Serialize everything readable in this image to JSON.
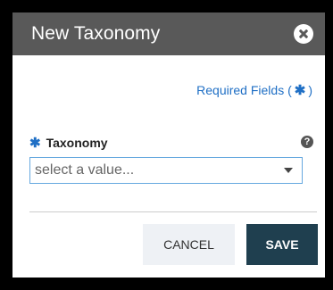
{
  "dialog": {
    "title": "New Taxonomy",
    "close_icon": "close-icon"
  },
  "required": {
    "prefix": "Required Fields (",
    "star": "✱",
    "suffix": ")"
  },
  "field": {
    "star": "✱",
    "label": "Taxonomy",
    "help_icon": "?",
    "placeholder": "select a value..."
  },
  "buttons": {
    "cancel": "CANCEL",
    "save": "SAVE"
  },
  "colors": {
    "titlebar": "#595959",
    "accent": "#1f6fc5",
    "save": "#1f3f4f",
    "cancel": "#eef1f5"
  }
}
